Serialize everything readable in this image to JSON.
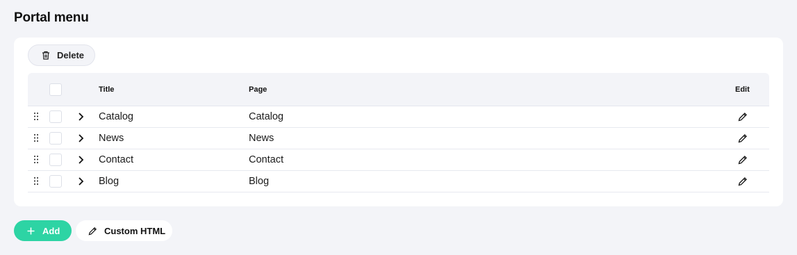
{
  "page": {
    "title": "Portal menu"
  },
  "toolbar": {
    "delete_label": "Delete"
  },
  "table": {
    "columns": {
      "title": "Title",
      "page": "Page",
      "edit": "Edit"
    },
    "rows": [
      {
        "title": "Catalog",
        "page": "Catalog"
      },
      {
        "title": "News",
        "page": "News"
      },
      {
        "title": "Contact",
        "page": "Contact"
      },
      {
        "title": "Blog",
        "page": "Blog"
      }
    ]
  },
  "footer": {
    "add_label": "Add",
    "custom_html_label": "Custom HTML"
  },
  "icons": {
    "delete": "trash-icon",
    "drag": "drag-handle-icon",
    "expand": "chevron-right-icon",
    "edit": "pencil-icon",
    "add": "plus-icon",
    "custom_html": "pencil-icon"
  },
  "colors": {
    "accent": "#2dd4a4",
    "background": "#f3f4f8",
    "card": "#ffffff"
  }
}
